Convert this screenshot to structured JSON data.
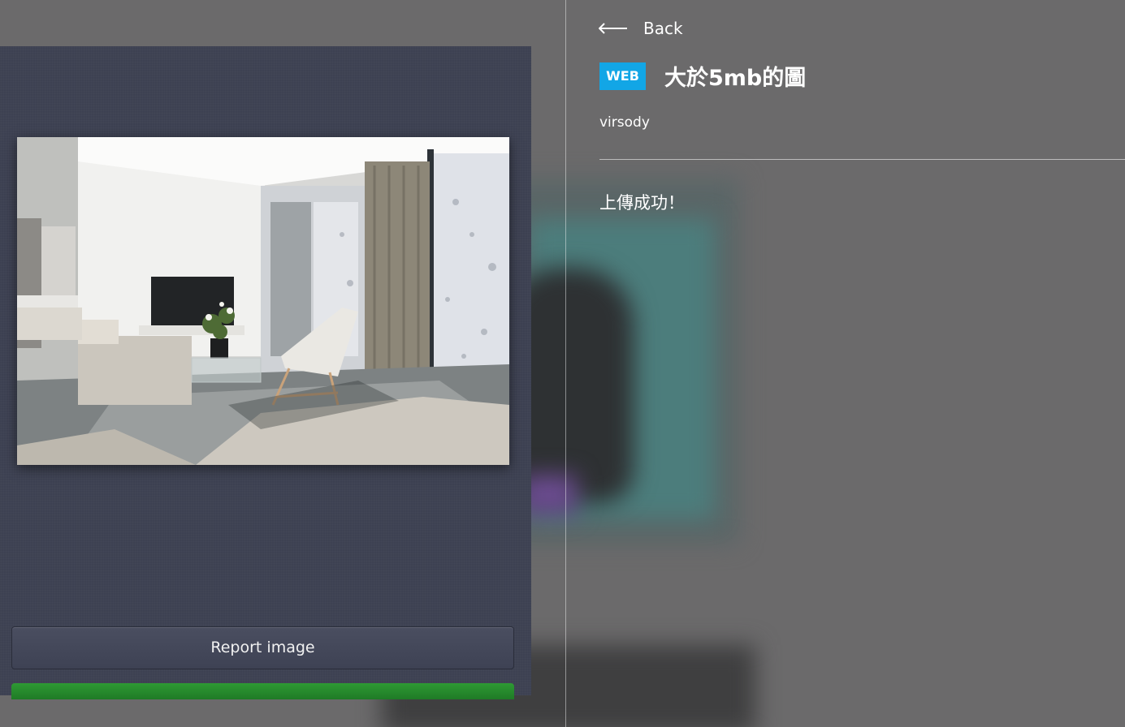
{
  "header": {
    "back_label": "Back"
  },
  "post": {
    "badge": "WEB",
    "title": "大於5mb的圖",
    "author": "virsody",
    "message": "上傳成功！"
  },
  "image_panel": {
    "report_label": "Report image",
    "photo_alt": "living room interior photo"
  },
  "colors": {
    "badge": "#12a6e6",
    "panel": "#3d4152",
    "green_button": "#1f7a26",
    "background": "#6b6a6b"
  }
}
